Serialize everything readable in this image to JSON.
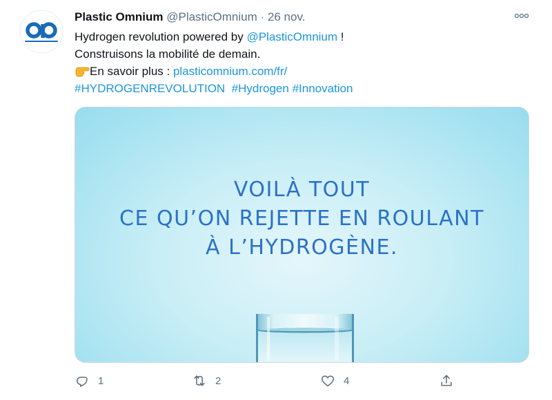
{
  "tweet": {
    "author_name": "Plastic Omnium",
    "handle": "@PlasticOmnium",
    "separator": "·",
    "date": "26 nov.",
    "avatar_icon": "plastic-omnium-logo",
    "more_icon": "more-dots-icon",
    "text": {
      "line1_prefix": "Hydrogen revolution powered by ",
      "line1_mention": "@PlasticOmnium",
      "line1_suffix": " !",
      "line2": "Construisons la mobilité de demain.",
      "line3_icon": "pointing-finger-icon",
      "line3_prefix": "En savoir plus : ",
      "line3_link": "plasticomnium.com/fr/",
      "hashtag1": "#HYDROGENREVOLUTION",
      "hashtag2": "#Hydrogen",
      "hashtag3": "#Innovation"
    },
    "media": {
      "headline_line1": "VOILÀ TOUT",
      "headline_line2": "CE QU’ON REJETTE EN ROULANT",
      "headline_line3": "À L’HYDROGÈNE.",
      "text_color": "#2a71c8",
      "background_color": "#a8e3f1"
    },
    "actions": {
      "reply_count": "1",
      "retweet_count": "2",
      "like_count": "4",
      "share_count": ""
    },
    "colors": {
      "link": "#1b95e0",
      "secondary_text": "#5b7083",
      "brand": "#1a6bb5"
    }
  }
}
